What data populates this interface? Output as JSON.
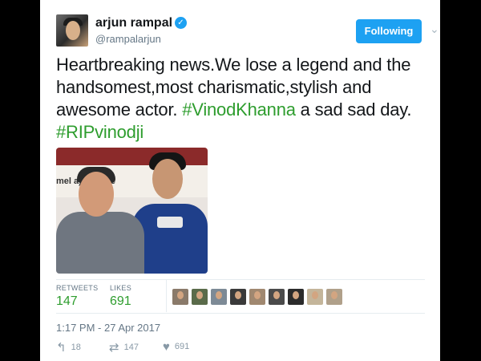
{
  "tweet": {
    "author_name": "arjun rampal",
    "handle": "@rampalarjun",
    "follow_label": "Following",
    "text_parts": [
      {
        "text": "Heartbreaking news.We lose a legend and the handsomest,most charismatic,stylish and awesome actor. ",
        "type": "text"
      },
      {
        "text": "#VinodKhanna",
        "type": "hashtag"
      },
      {
        "text": " a sad sad day. ",
        "type": "text"
      },
      {
        "text": "#RIPvinodji",
        "type": "hashtag"
      }
    ],
    "photo_banner_text": "mel    a) Ltd.    me",
    "stats": {
      "retweets_label": "RETWEETS",
      "retweets_value": "147",
      "likes_label": "LIKES",
      "likes_value": "691"
    },
    "timestamp": "1:17 PM - 27 Apr 2017",
    "actions": {
      "reply_icon": "reply-icon",
      "reply_count": "18",
      "retweet_icon": "retweet-icon",
      "retweet_count": "147",
      "like_icon": "heart-icon",
      "like_count": "691"
    },
    "liker_colors": [
      "#8a7a6a",
      "#5a6b4a",
      "#7d8a96",
      "#3a3a3a",
      "#a08870",
      "#4a4a4a",
      "#2b2b2b",
      "#c4b59a",
      "#b0a08a"
    ]
  },
  "colors": {
    "hashtag": "#2e9d2e",
    "follow_button": "#1da1f2",
    "verified": "#1da1f2",
    "stat_value": "#2e9d2e"
  }
}
